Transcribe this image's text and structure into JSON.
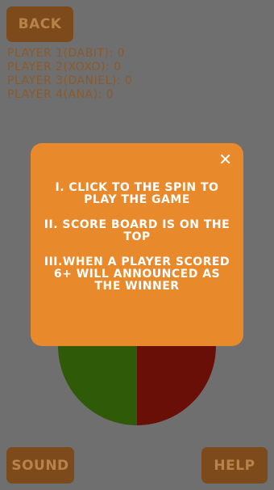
{
  "buttons": {
    "back": "BACK",
    "sound": "SOUND",
    "help": "HELP"
  },
  "scoreboard": [
    "PLAYER 1(DABIT): 0",
    "PLAYER 2(XOXO): 0",
    "PLAYER 3(DANIEL): 0",
    "PLAYER 4(ANA): 0"
  ],
  "modal": {
    "close_glyph": "✕",
    "instructions": [
      "I. CLICK TO THE SPIN TO PLAY THE GAME",
      "II. SCORE BOARD IS ON THE TOP",
      "III.WHEN A PLAYER SCORED 6+ WILL ANNOUNCED AS THE WINNER"
    ]
  },
  "wheel": {
    "segment_colors": [
      "#2f5a08",
      "#6a0e08"
    ]
  },
  "colors": {
    "background": "#6f6f6f",
    "button": "#7d4a1c",
    "button_text": "#b9824a",
    "scoreboard_text": "#8a5a2b",
    "modal": "#e88a2c"
  }
}
